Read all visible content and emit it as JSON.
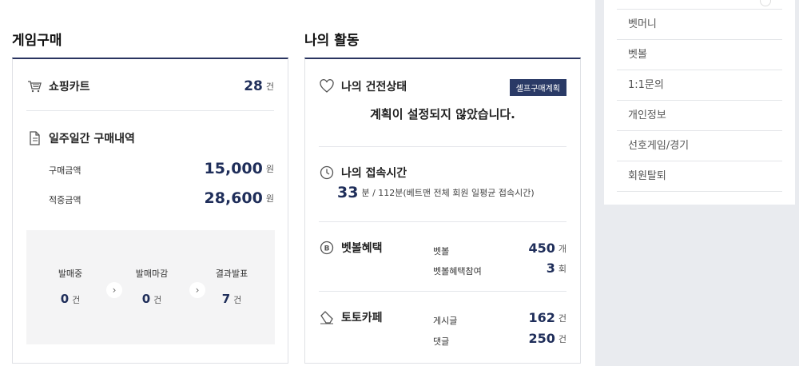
{
  "sections": {
    "game_purchase": "게임구매",
    "my_activity": "나의 활동"
  },
  "shopping_cart": {
    "label": "쇼핑카트",
    "count": "28",
    "unit": "건"
  },
  "weekly": {
    "title": "일주일간 구매내역",
    "purchase_label": "구매금액",
    "purchase_value": "15,000",
    "purchase_unit": "원",
    "points_label": "적중금액",
    "points_value": "28,600",
    "points_unit": "원"
  },
  "status": {
    "selling": {
      "label": "발매중",
      "value": "0",
      "unit": "건"
    },
    "closed": {
      "label": "발매마감",
      "value": "0",
      "unit": "건"
    },
    "result": {
      "label": "결과발표",
      "value": "7",
      "unit": "건"
    }
  },
  "health": {
    "title": "나의 건전상태",
    "badge": "셀프구매계획",
    "message": "계획이 설정되지 않았습니다."
  },
  "access": {
    "title": "나의 접속시간",
    "value": "33",
    "detail": "분 / 112분(베트맨 전체 회원 일평균 접속시간)"
  },
  "betball": {
    "title": "벳볼혜택",
    "r1_label": "벳볼",
    "r1_value": "450",
    "r1_unit": "개",
    "r2_label": "벳볼혜택참여",
    "r2_value": "3",
    "r2_unit": "회"
  },
  "toto": {
    "title": "토토카페",
    "r1_label": "게시글",
    "r1_value": "162",
    "r1_unit": "건",
    "r2_label": "댓글",
    "r2_value": "250",
    "r2_unit": "건"
  },
  "side_menu": {
    "items": [
      "벳머니",
      "벳볼",
      "1:1문의",
      "개인정보",
      "선호게임/경기",
      "회원탈퇴"
    ]
  },
  "colors": {
    "navy": "#2a3460",
    "number": "#1f2e5a",
    "side_bg": "#e9ebef"
  }
}
